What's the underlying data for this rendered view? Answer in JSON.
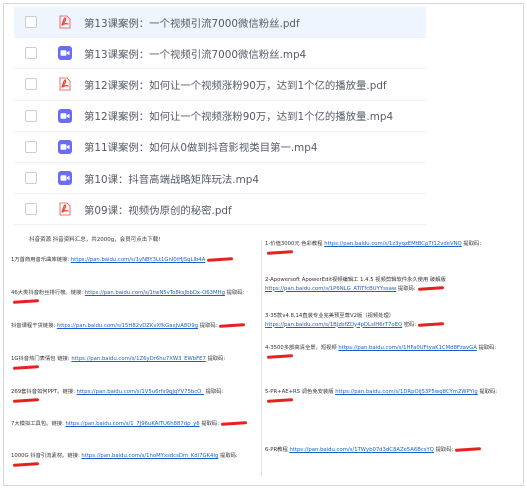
{
  "files": [
    {
      "name": "第13课案例：一个视频引流7000微信粉丝.pdf",
      "type": "pdf",
      "selected": true
    },
    {
      "name": "第13课案例：一个视频引流7000微信粉丝.mp4",
      "type": "video",
      "selected": false
    },
    {
      "name": "第12课案例：如何让一个视频涨粉90万，达到1个亿的播放量.pdf",
      "type": "pdf",
      "selected": false
    },
    {
      "name": "第12课案例：如何让一个视频涨粉90万，达到1个亿的播放量.mp4",
      "type": "video",
      "selected": false
    },
    {
      "name": "第11课案例：如何从0做到抖音影视类目第一.mp4",
      "type": "video",
      "selected": false
    },
    {
      "name": "第10课：抖音高端战略矩阵玩法.mp4",
      "type": "video",
      "selected": false
    },
    {
      "name": "第09课：视频伪原创的秘密.pdf",
      "type": "pdf",
      "selected": false
    }
  ],
  "colors": {
    "pdf": "#f0493f",
    "video": "#6a6cf6",
    "link": "#1a5fc9",
    "redact": "#e52222"
  },
  "doc": {
    "title": "抖音资源   抖音资料汇总，共2000g，会员可点击下载!",
    "left": [
      {
        "a": "1万首商用音乐曲库链接:",
        "link": "https://pan.baidu.com/s/1yNBY3Lt1GnI0iHJSqLlb4A"
      },
      {
        "a": "46大类抖音粉丝排行榜。链接:",
        "link": "https://pan.baidu.com/s/1twN5vTo8ksJbbDx-O63MHg",
        "b": "提取码:"
      },
      {
        "a": "抖音课程干货链接:",
        "link": "https://pan.baidu.com/s/15H82vDZKvXfkGaxJvA8D9g",
        "b": "提取码:"
      },
      {
        "a": "1G抖音热门表情包 链接:",
        "link": "https://pan.baidu.com/s/1Z6yDr6hu7XW3_EWbFE7",
        "b": "提取码:"
      },
      {
        "a": "269套抖音如何PPT。链接:",
        "link": "https://pan.baidu.com/s/1V5u6rfx9qJqYV75bcO_",
        "b": "提取码:"
      },
      {
        "a": "7大模拟工具包。链接:",
        "link": "https://pan.baidu.com/s/1_7J96uKAlTU6h887dp_y6",
        "b": "提取码:"
      },
      {
        "a": "1000G 抖音引流素材。链接:",
        "link": "https://pan.baidu.com/s/1hoMYxsdcsDm_Kdl7GK4Ig",
        "b": "提取码:"
      }
    ],
    "right": [
      {
        "a": "1-价值3000元 色彩教程",
        "link": "https://pan.baidu.com/s/1z3yqzEMtBCpTf12vdeVNQ",
        "b": "提取码:"
      },
      {
        "a": "2-Apowersoft ApowerEdit视频编辑工 1.4.5 视频剪辑软件永久使用 破解版",
        "link": "https://pan.baidu.com/s/1P6NLG_ATiTfcBUYYssaw",
        "b": "提取码:"
      },
      {
        "a": "3-35款v4.8.14直装专业完美预至尊V2版（视频处理）",
        "link": "https://pan.baidu.com/s/1BJzbfZDy4pDLsIH6rT7oEQ",
        "b": "密码:"
      },
      {
        "a": "4-3500多部高清全景，短视频",
        "link": "https://pan.baidu.com/s/1HFa0UFtyaK1CMd8FzavGA",
        "b": "提取码:"
      },
      {
        "a": "5-PR+AE+RS 调色免安装版",
        "link": "https://pan.baidu.com/s/1DRpOlj53P5wq8CYm2WPYlg",
        "b": "提取码:"
      },
      {
        "a": "6-PR教程",
        "link": "https://pan.baidu.com/s/1TWyb07d3dC8AZe5A6BcsYQ",
        "b": "提取码:"
      }
    ]
  }
}
